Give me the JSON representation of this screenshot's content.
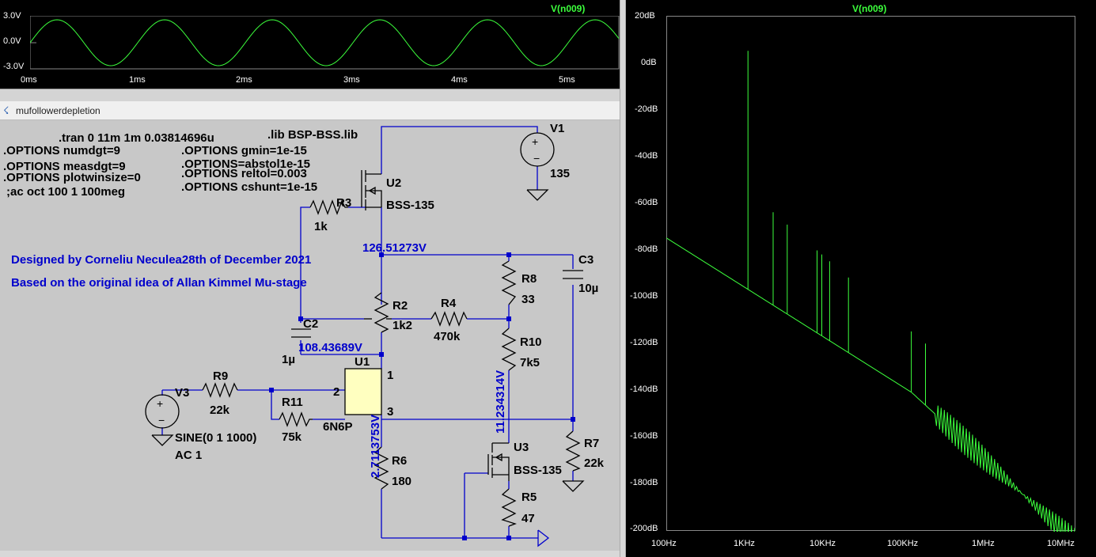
{
  "top_plot": {
    "trace": "V(n009)",
    "y_ticks": [
      "3.0V",
      "0.0V",
      "-3.0V"
    ],
    "x_ticks": [
      "0ms",
      "1ms",
      "2ms",
      "3ms",
      "4ms",
      "5ms"
    ]
  },
  "fft_plot": {
    "trace": "V(n009)",
    "y_ticks": [
      "20dB",
      "0dB",
      "-20dB",
      "-40dB",
      "-60dB",
      "-80dB",
      "-100dB",
      "-120dB",
      "-140dB",
      "-160dB",
      "-180dB",
      "-200dB"
    ],
    "x_ticks": [
      "100Hz",
      "1KHz",
      "10KHz",
      "100KHz",
      "1MHz",
      "10MHz"
    ]
  },
  "schematic": {
    "window_title": "mufollowerdepletion",
    "directives": {
      "tran": ".tran 0 11m 1m 0.03814696u",
      "lib": ".lib BSP-BSS.lib",
      "numdgt": ".OPTIONS numdgt=9",
      "gmin": ".OPTIONS gmin=1e-15",
      "measdgt": ".OPTIONS measdgt=9",
      "abstol": ".OPTIONS=abstol1e-15",
      "plotwinsize": ".OPTIONS plotwinsize=0",
      "reltol": ".OPTIONS reltol=0.003",
      "ac": ";ac oct 100 1 100meg",
      "cshunt": ".OPTIONS cshunt=1e-15"
    },
    "notes": {
      "designed": "Designed by Corneliu Neculea28th of December 2021",
      "based": "Based on the original idea of Allan Kimmel Mu-stage"
    },
    "voltages": {
      "v1": "126.51273V",
      "v2": "108.43689V",
      "v3": "11.234314V",
      "v4": "2.7113753V"
    },
    "components": {
      "V1": "V1",
      "V1_val": "135",
      "U2": "U2",
      "U2_val": "BSS-135",
      "R3": "R3",
      "R3_val": "1k",
      "C3": "C3",
      "C3_val": "10µ",
      "R8": "R8",
      "R8_val": "33",
      "R2": "R2",
      "R2_val": "1k2",
      "R4": "R4",
      "R4_val": "470k",
      "C2": "C2",
      "C2_val": "1µ",
      "R10": "R10",
      "R10_val": "7k5",
      "U1": "U1",
      "U1_val": "6N6P",
      "pin1": "1",
      "pin2": "2",
      "pin3": "3",
      "V3": "V3",
      "V3_val1": "SINE(0 1 1000)",
      "V3_val2": "AC 1",
      "R9": "R9",
      "R9_val": "22k",
      "R11": "R11",
      "R11_val": "75k",
      "R7": "R7",
      "R7_val": "22k",
      "U3": "U3",
      "U3_val": "BSS-135",
      "R6": "R6",
      "R6_val": "180",
      "R5": "R5",
      "R5_val": "47"
    }
  },
  "colors": {
    "trace": "#3cff3c",
    "wire": "#0000cc",
    "component": "#000000",
    "schematic_bg": "#c8c8c8",
    "plot_bg": "#000000",
    "ic_fill": "#ffffc0"
  }
}
